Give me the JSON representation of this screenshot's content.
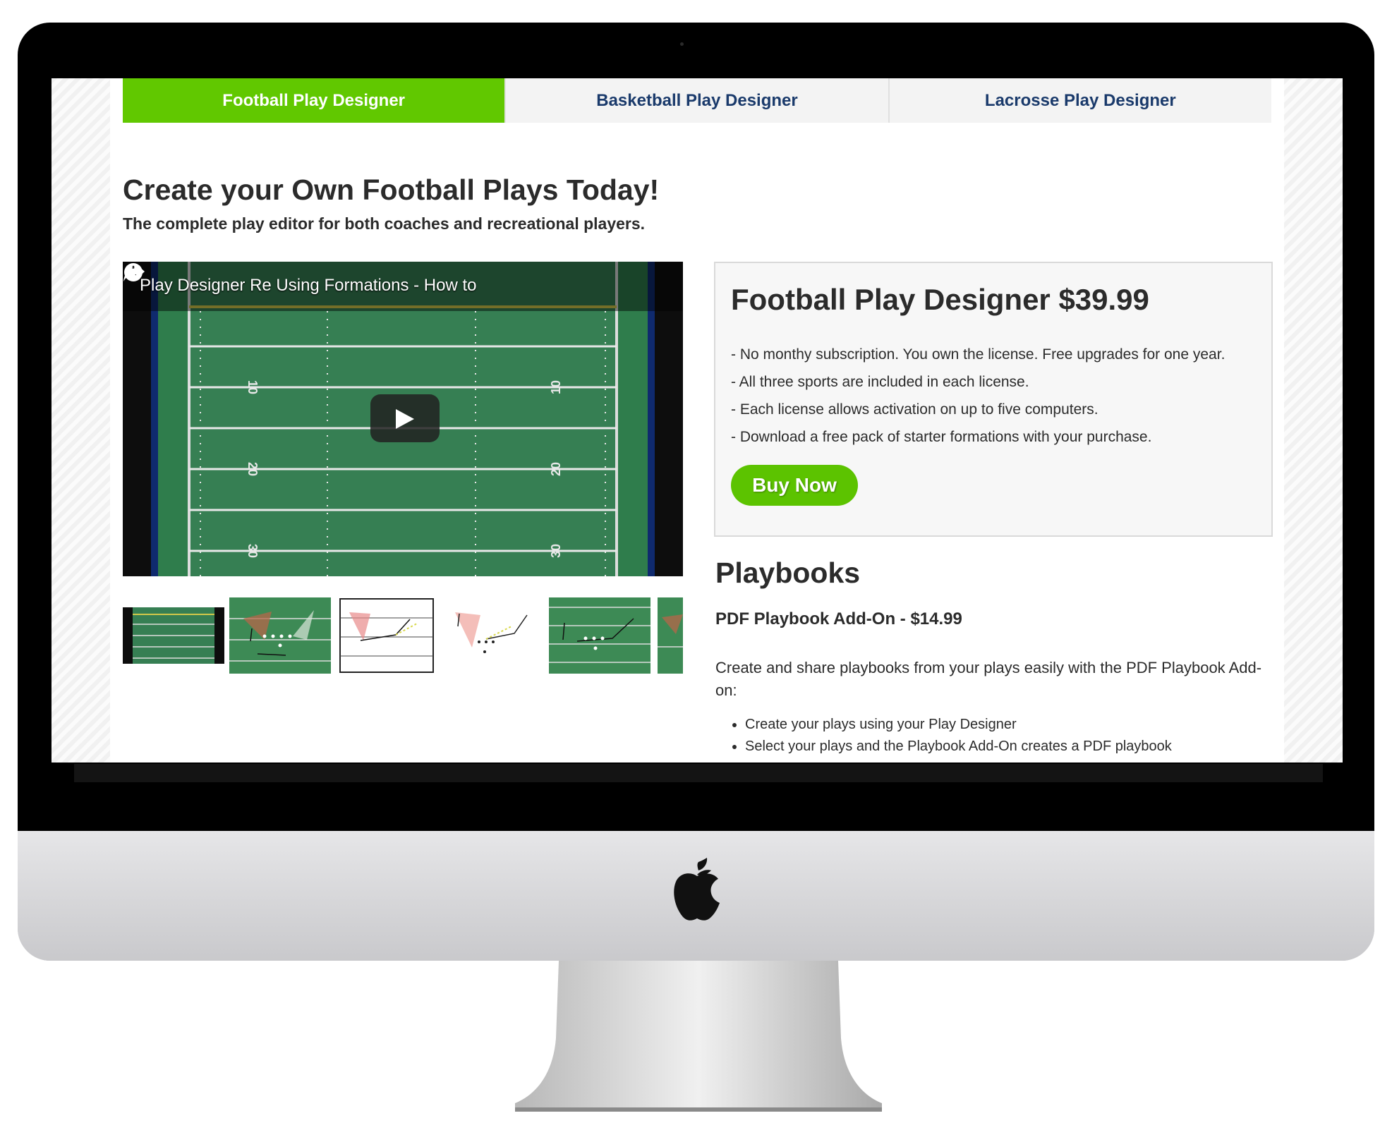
{
  "tabs": [
    {
      "label": "Football Play Designer",
      "active": true
    },
    {
      "label": "Basketball Play Designer",
      "active": false
    },
    {
      "label": "Lacrosse Play Designer",
      "active": false
    }
  ],
  "hero": {
    "title": "Create your Own Football Plays Today!",
    "subtitle": "The complete play editor for both coaches and recreational players."
  },
  "video": {
    "title": "Play Designer Re Using Formations - How to",
    "icons": {
      "watch_later": "clock-icon",
      "share": "share-icon",
      "play": "play-icon"
    },
    "yard_numbers": [
      "10",
      "20",
      "30"
    ]
  },
  "product": {
    "title": "Football Play Designer $39.99",
    "features": [
      "- No monthy subscription. You own the license. Free upgrades for one year.",
      "- All three sports are included in each license.",
      "- Each license allows activation on up to five computers.",
      "- Download a free pack of starter formations with your purchase."
    ],
    "buy_label": "Buy Now"
  },
  "playbooks": {
    "title": "Playbooks",
    "subtitle": "PDF Playbook Add-On - $14.99",
    "description": "Create and share playbooks from your plays easily with the PDF Playbook Add-on:",
    "bullets": [
      "Create your plays using your Play Designer",
      "Select your plays and the Playbook Add-On creates a PDF playbook"
    ]
  },
  "colors": {
    "accent_green": "#61c800",
    "tab_text_blue": "#1a3a6b",
    "field_green": "#2f7d4c"
  }
}
